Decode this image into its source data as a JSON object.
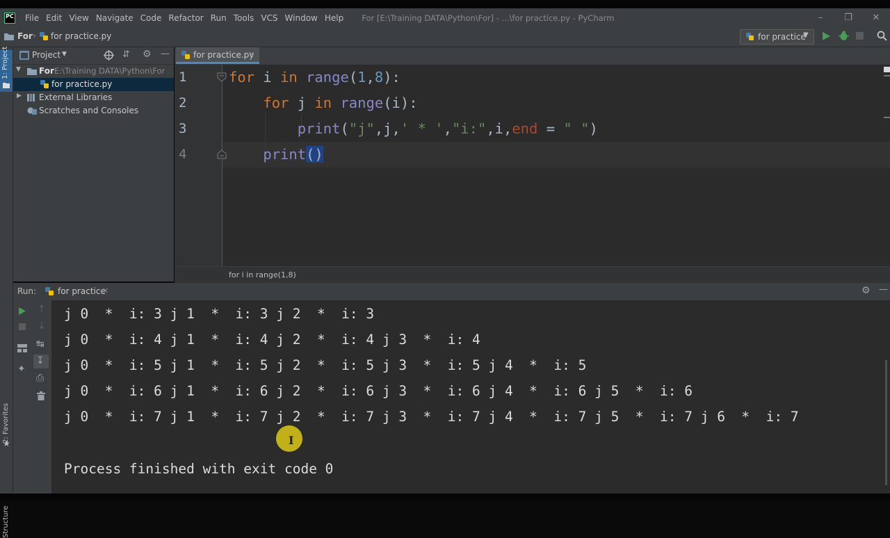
{
  "app": {
    "window_title": "For [E:\\Training DATA\\Python\\For] - ...\\for practice.py - PyCharm",
    "menu": [
      "File",
      "Edit",
      "View",
      "Navigate",
      "Code",
      "Refactor",
      "Run",
      "Tools",
      "VCS",
      "Window",
      "Help"
    ]
  },
  "navbar": {
    "crumbs": [
      "For",
      "for practice.py"
    ],
    "run_config": "for practice"
  },
  "project": {
    "header": "Project",
    "side_label": "1: Project",
    "tree": {
      "root_name": "For",
      "root_path": "E:\\Training DATA\\Python\\For",
      "file": "for practice.py",
      "ext_libs": "External Libraries",
      "scratches": "Scratches and Consoles"
    }
  },
  "editor": {
    "tab": "for practice.py",
    "line_numbers": [
      "1",
      "2",
      "3",
      "4"
    ],
    "breadcrumb": "for i in range(1,8)"
  },
  "run": {
    "label": "Run:",
    "tab": "for practice",
    "output": [
      "j 0  *  i: 3 j 1  *  i: 3 j 2  *  i: 3",
      "j 0  *  i: 4 j 1  *  i: 4 j 2  *  i: 4 j 3  *  i: 4",
      "j 0  *  i: 5 j 1  *  i: 5 j 2  *  i: 5 j 3  *  i: 5 j 4  *  i: 5",
      "j 0  *  i: 6 j 1  *  i: 6 j 2  *  i: 6 j 3  *  i: 6 j 4  *  i: 6 j 5  *  i: 6",
      "j 0  *  i: 7 j 1  *  i: 7 j 2  *  i: 7 j 3  *  i: 7 j 4  *  i: 7 j 5  *  i: 7 j 6  *  i: 7"
    ],
    "finish": "Process finished with exit code 0"
  },
  "side_labels": {
    "favorites": "2: Favorites",
    "structure": "Structure"
  },
  "colors": {
    "keyword": "#cc7832",
    "number": "#6897bb",
    "string": "#6a8759",
    "builtin": "#8888c6",
    "kwarg": "#aa4926",
    "run_green": "#499c54"
  }
}
